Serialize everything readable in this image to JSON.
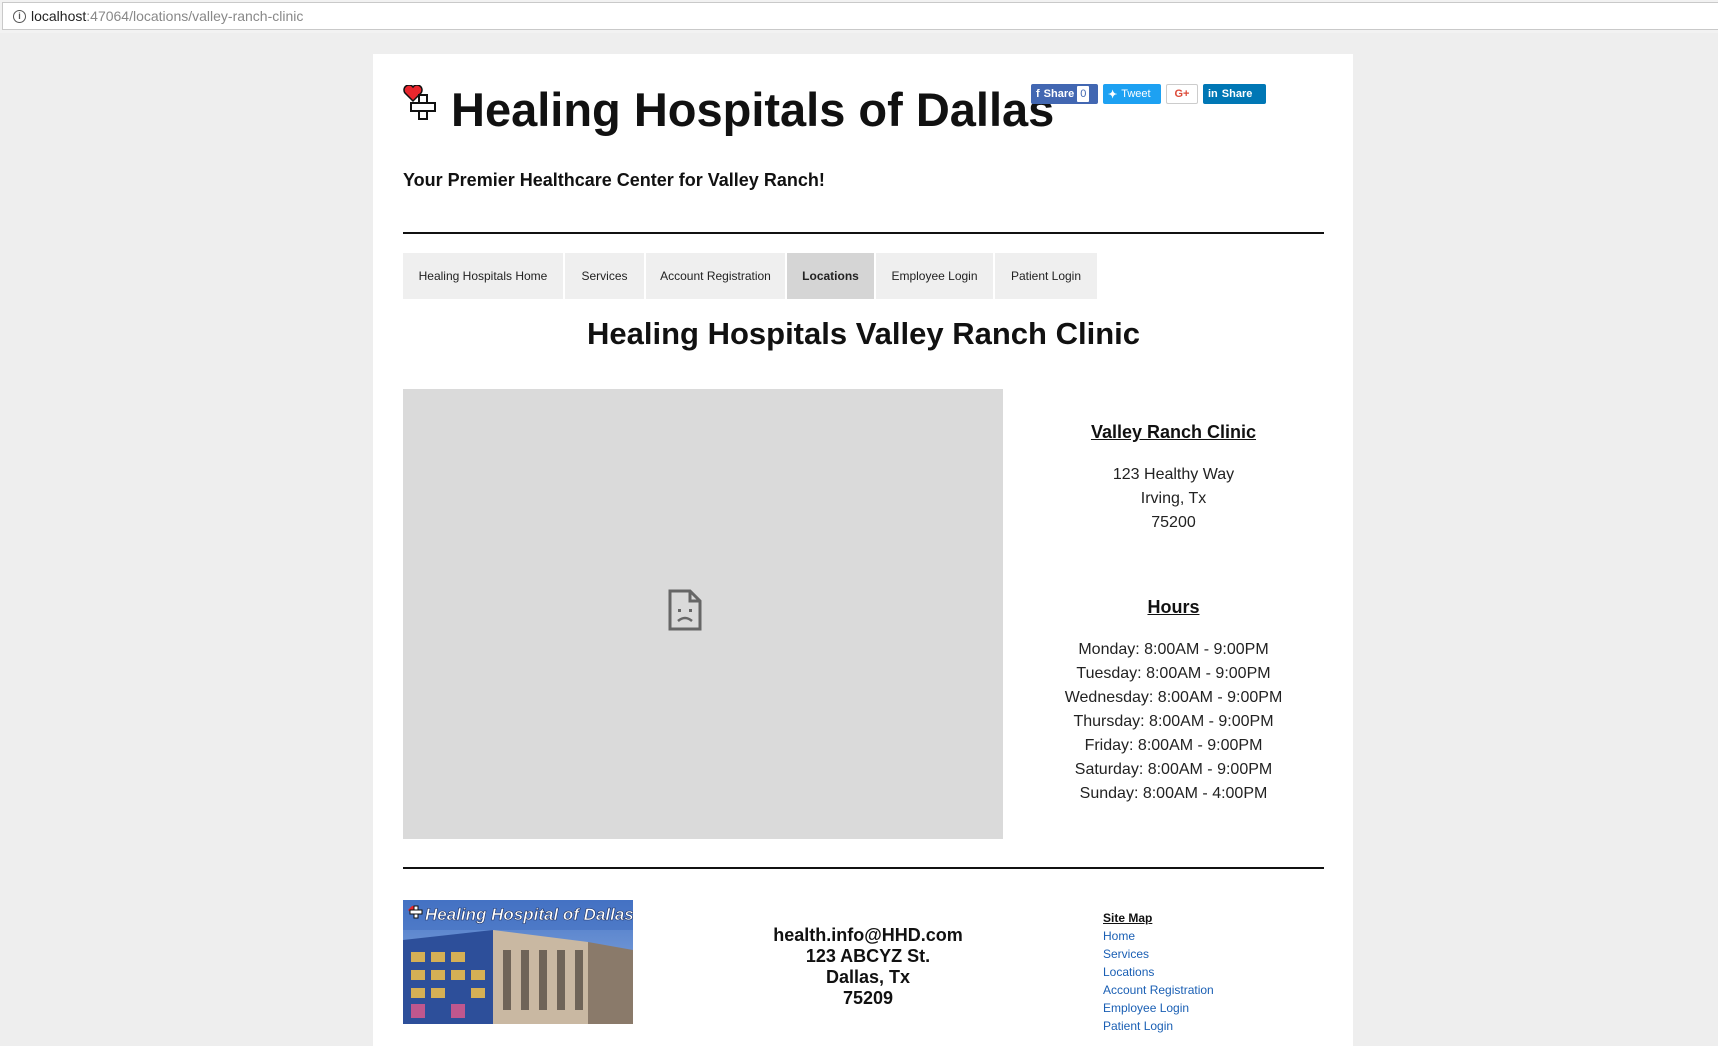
{
  "browser": {
    "url_host": "localhost",
    "url_path": ":47064/locations/valley-ranch-clinic"
  },
  "header": {
    "title": "Healing Hospitals of Dallas",
    "tagline": "Your Premier Healthcare Center for Valley Ranch!",
    "logo_icon": "heart-cross-icon"
  },
  "share": {
    "facebook_label": "Share",
    "facebook_count": "0",
    "twitter_label": "Tweet",
    "google_label": "G+",
    "linkedin_label": "Share"
  },
  "nav": {
    "items": [
      {
        "label": "Healing Hospitals Home"
      },
      {
        "label": "Services"
      },
      {
        "label": "Account Registration"
      },
      {
        "label": "Locations",
        "active": true
      },
      {
        "label": "Employee Login"
      },
      {
        "label": "Patient Login"
      }
    ]
  },
  "main": {
    "heading": "Healing Hospitals Valley Ranch Clinic",
    "map_icon": "broken-document-icon",
    "clinic_name": "Valley Ranch Clinic",
    "address": [
      "123 Healthy Way",
      "Irving, Tx",
      "75200"
    ],
    "hours_heading": "Hours",
    "hours": [
      "Monday: 8:00AM - 9:00PM",
      "Tuesday: 8:00AM - 9:00PM",
      "Wednesday: 8:00AM - 9:00PM",
      "Thursday: 8:00AM - 9:00PM",
      "Friday: 8:00AM - 9:00PM",
      "Saturday: 8:00AM - 9:00PM",
      "Sunday: 8:00AM - 4:00PM"
    ]
  },
  "footer": {
    "image_caption": "Healing Hospital of Dallas",
    "contact": [
      "health.info@HHD.com",
      "123 ABCYZ St.",
      "Dallas, Tx",
      "75209"
    ],
    "sitemap_title": "Site Map",
    "sitemap_links": [
      "Home",
      "Services",
      "Locations",
      "Account Registration",
      "Employee Login",
      "Patient Login"
    ]
  },
  "colors": {
    "facebook": "#4267b2",
    "twitter": "#1da1f2",
    "google": "#dd4b39",
    "linkedin": "#0077b5",
    "link": "#1a5fb4",
    "logo_red": "#e8262d"
  }
}
